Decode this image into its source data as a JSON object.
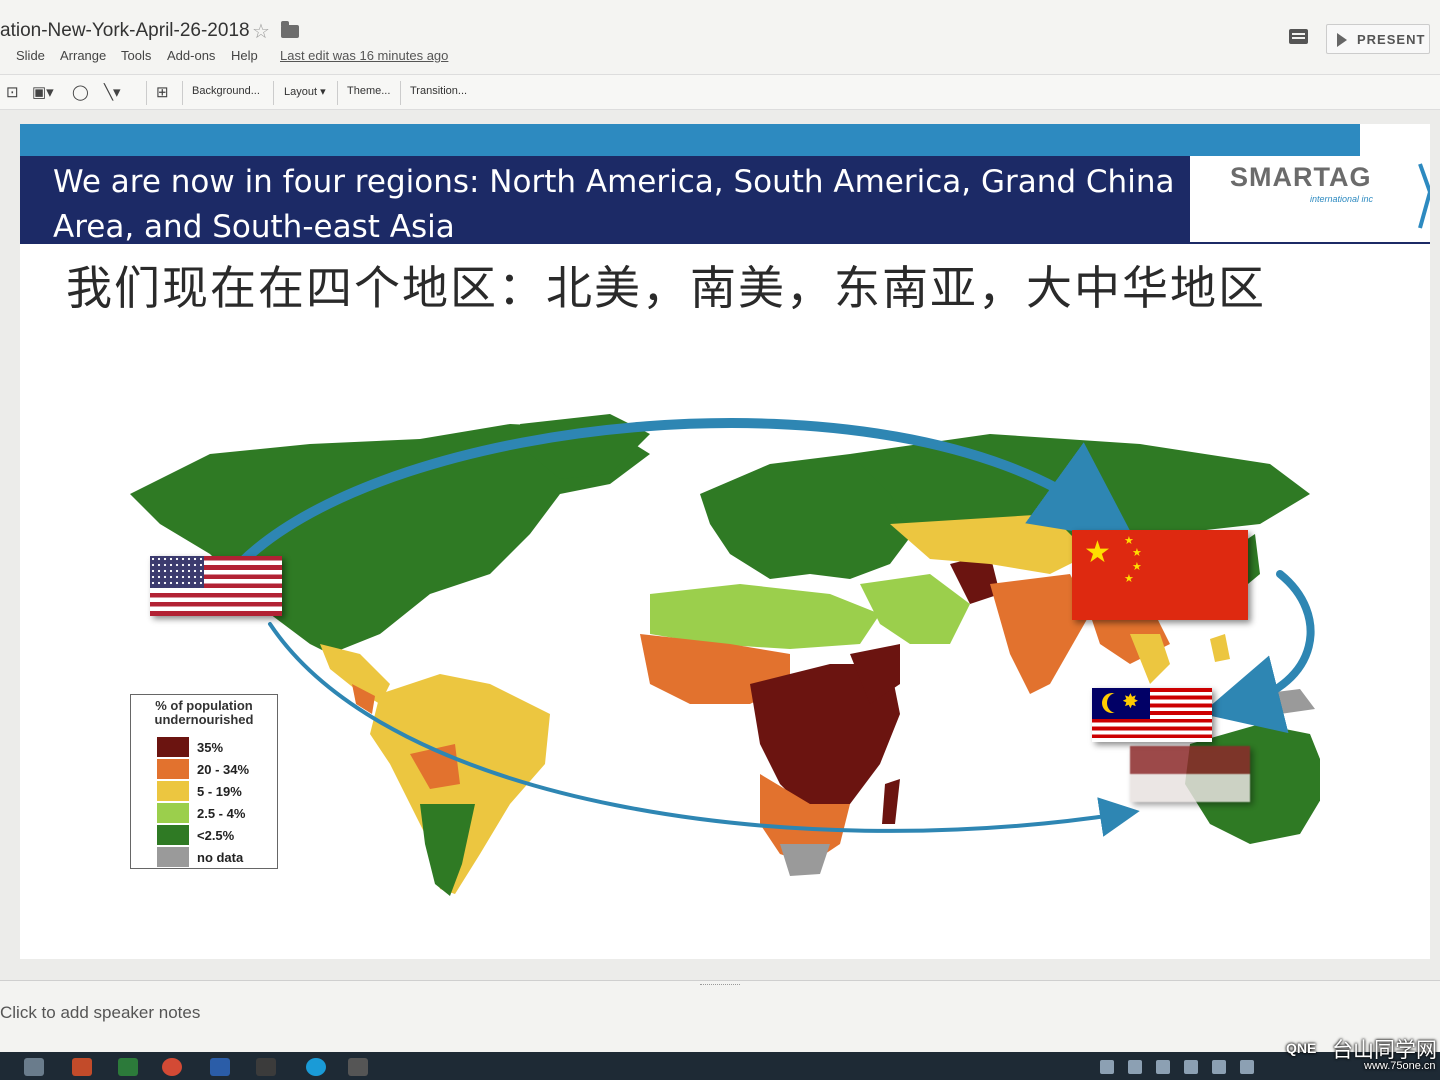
{
  "app": {
    "doc_title": "ation-New-York-April-26-2018",
    "last_edit": "Last edit was 16 minutes ago",
    "present_label": "PRESENT"
  },
  "menu": [
    "Slide",
    "Arrange",
    "Tools",
    "Add-ons",
    "Help"
  ],
  "toolbar": {
    "background": "Background...",
    "layout": "Layout",
    "theme": "Theme...",
    "transition": "Transition..."
  },
  "slide": {
    "title_en": "We  are now in four regions: North America, South America, Grand China Area, and South-east Asia",
    "title_cn": "我们现在在四个地区：北美，南美，东南亚，大中华地区",
    "logo": "SMARTAG",
    "logo_sub": "international inc",
    "legend": {
      "title": "% of population undernourished",
      "items": [
        {
          "label": "35%",
          "color": "#6b1410"
        },
        {
          "label": "20 - 34%",
          "color": "#e2722e"
        },
        {
          "label": "5 - 19%",
          "color": "#ecc640"
        },
        {
          "label": "2.5 - 4%",
          "color": "#9bcf4c"
        },
        {
          "label": "<2.5%",
          "color": "#2f7a24"
        },
        {
          "label": "no data",
          "color": "#9a9a9a"
        }
      ]
    },
    "flags": [
      "united-states",
      "china",
      "malaysia",
      "indonesia"
    ]
  },
  "notes": {
    "placeholder": "Click to add speaker notes"
  },
  "watermark": {
    "brand": "台山同学网",
    "logo": "QNE",
    "url": "www.75one.cn"
  },
  "colors": {
    "title_band": "#1c2a66",
    "accent_strip": "#2d8ac0",
    "arrow": "#2e86b3"
  }
}
